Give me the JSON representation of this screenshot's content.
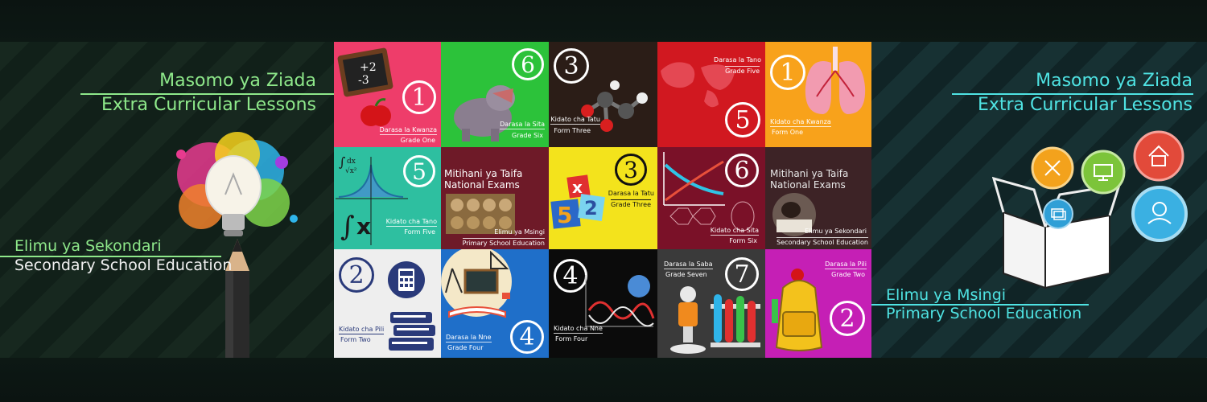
{
  "left_panel": {
    "heading_sw": "Masomo ya Ziada",
    "heading_en": "Extra Curricular Lessons",
    "sub_sw": "Elimu ya Sekondari",
    "sub_en": "Secondary School Education"
  },
  "right_panel": {
    "heading_sw": "Masomo ya Ziada",
    "heading_en": "Extra Curricular Lessons",
    "sub_sw": "Elimu ya Msingi",
    "sub_en": "Primary School Education"
  },
  "tiles": {
    "t1": {
      "number": "1",
      "sw": "Darasa la Kwanza",
      "en": "Grade One",
      "color": "#ee3d6a"
    },
    "t2": {
      "number": "6",
      "sw": "Darasa la Sita",
      "en": "Grade Six",
      "color": "#2cc23a"
    },
    "t3": {
      "number": "3",
      "sw": "Kidato cha Tatu",
      "en": "Form Three",
      "color": "#2b1d17"
    },
    "t4": {
      "number": "5",
      "sw": "Darasa la Tano",
      "en": "Grade Five",
      "color": "#d11820"
    },
    "t5": {
      "number": "1",
      "sw": "Kidato cha Kwanza",
      "en": "Form One",
      "color": "#f8a21b"
    },
    "t6": {
      "number": "5",
      "sw": "Kidato cha Tano",
      "en": "Form Five",
      "color": "#2ebfa0"
    },
    "t7": {
      "title_sw": "Mitihani ya Taifa",
      "title_en": "National Exams",
      "sw": "Elimu ya Msingi",
      "en": "Primary School Education",
      "color": "#6e1a28"
    },
    "t8": {
      "number": "3",
      "sw": "Darasa la Tatu",
      "en": "Grade Three",
      "color": "#f3e31c"
    },
    "t9": {
      "number": "6",
      "sw": "Kidato cha Sita",
      "en": "Form Six",
      "color": "#7a1128"
    },
    "t10": {
      "title_sw": "Mitihani ya Taifa",
      "title_en": "National Exams",
      "sw": "Elimu ya Sekondari",
      "en": "Secondary School Education",
      "color": "#3d2326"
    },
    "t11": {
      "number": "2",
      "sw": "Kidato cha Pili",
      "en": "Form Two",
      "color": "#eeeeee"
    },
    "t12": {
      "number": "4",
      "sw": "Darasa la Nne",
      "en": "Grade Four",
      "color": "#1f6fc9"
    },
    "t13": {
      "number": "4",
      "sw": "Kidato cha Nne",
      "en": "Form Four",
      "color": "#0b0b0b"
    },
    "t14": {
      "number": "7",
      "sw": "Darasa la Saba",
      "en": "Grade Seven",
      "color": "#3a3a3a"
    },
    "t15": {
      "number": "2",
      "sw": "Darasa la Pili",
      "en": "Grade Two",
      "color": "#c51fb5"
    }
  },
  "icons": [
    "chalkboard-icon",
    "apple-icon",
    "hippo-icon",
    "molecule-icon",
    "world-map-icon",
    "lungs-icon",
    "integral-formula-icon",
    "exam-papers-icon",
    "number-blocks-icon",
    "graph-icon",
    "exam-student-icon",
    "calculator-icon",
    "books-icon",
    "classroom-board-icon",
    "dna-icon",
    "microscope-icon",
    "test-tubes-icon",
    "school-bag-icon",
    "light-bulb-icon",
    "pencil-icon",
    "open-box-icon",
    "home-icon",
    "monitor-icon",
    "tools-icon",
    "user-icon",
    "cards-icon"
  ]
}
